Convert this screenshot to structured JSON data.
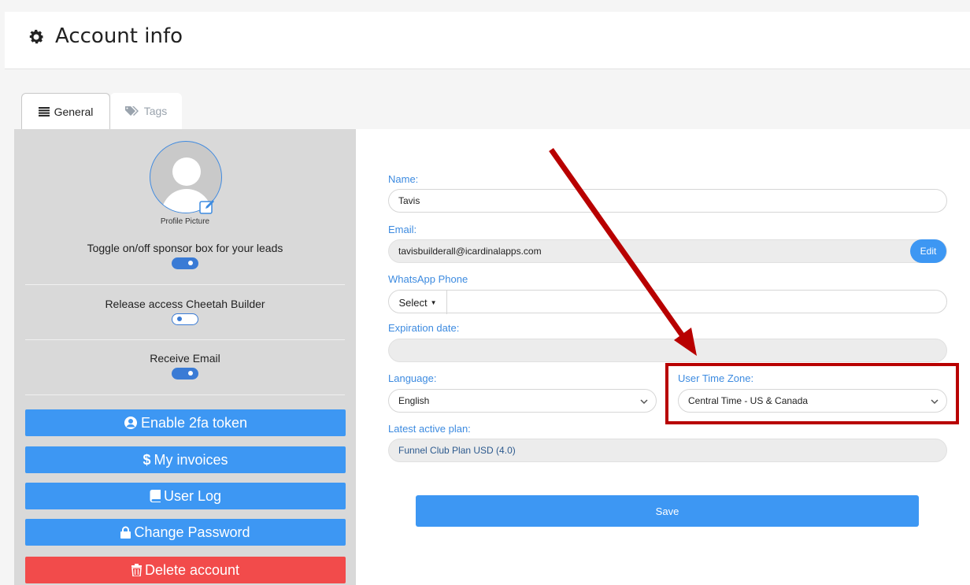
{
  "header": {
    "title": "Account info",
    "icon": "gear-icon"
  },
  "tabs": [
    {
      "label": "General",
      "icon": "list-icon",
      "active": true
    },
    {
      "label": "Tags",
      "icon": "tags-icon",
      "active": false
    }
  ],
  "sidebar": {
    "profile_picture_label": "Profile Picture",
    "toggles": [
      {
        "label": "Toggle on/off sponsor box for your leads",
        "on": true
      },
      {
        "label": "Release access Cheetah Builder",
        "on": false
      },
      {
        "label": "Receive Email",
        "on": true
      }
    ],
    "actions": [
      {
        "label": "Enable 2fa token",
        "icon": "user-circle-icon"
      },
      {
        "label": "My invoices",
        "icon": "dollar-icon"
      },
      {
        "label": "User Log",
        "icon": "book-icon"
      },
      {
        "label": "Change Password",
        "icon": "lock-icon"
      },
      {
        "label": "Delete account",
        "icon": "trash-icon"
      }
    ]
  },
  "form": {
    "name": {
      "label": "Name:",
      "value": "Tavis"
    },
    "email": {
      "label": "Email:",
      "value": "tavisbuilderall@icardinalapps.com",
      "edit_label": "Edit"
    },
    "whatsapp": {
      "label": "WhatsApp Phone",
      "select_label": "Select",
      "value": ""
    },
    "expiration": {
      "label": "Expiration date:",
      "value": ""
    },
    "language": {
      "label": "Language:",
      "value": "English"
    },
    "timezone": {
      "label": "User Time Zone:",
      "value": "Central Time - US & Canada"
    },
    "plan": {
      "label": "Latest active plan:",
      "value": "Funnel Club Plan USD (4.0)"
    },
    "save_label": "Save"
  },
  "annotation": {
    "color": "#b80000"
  }
}
